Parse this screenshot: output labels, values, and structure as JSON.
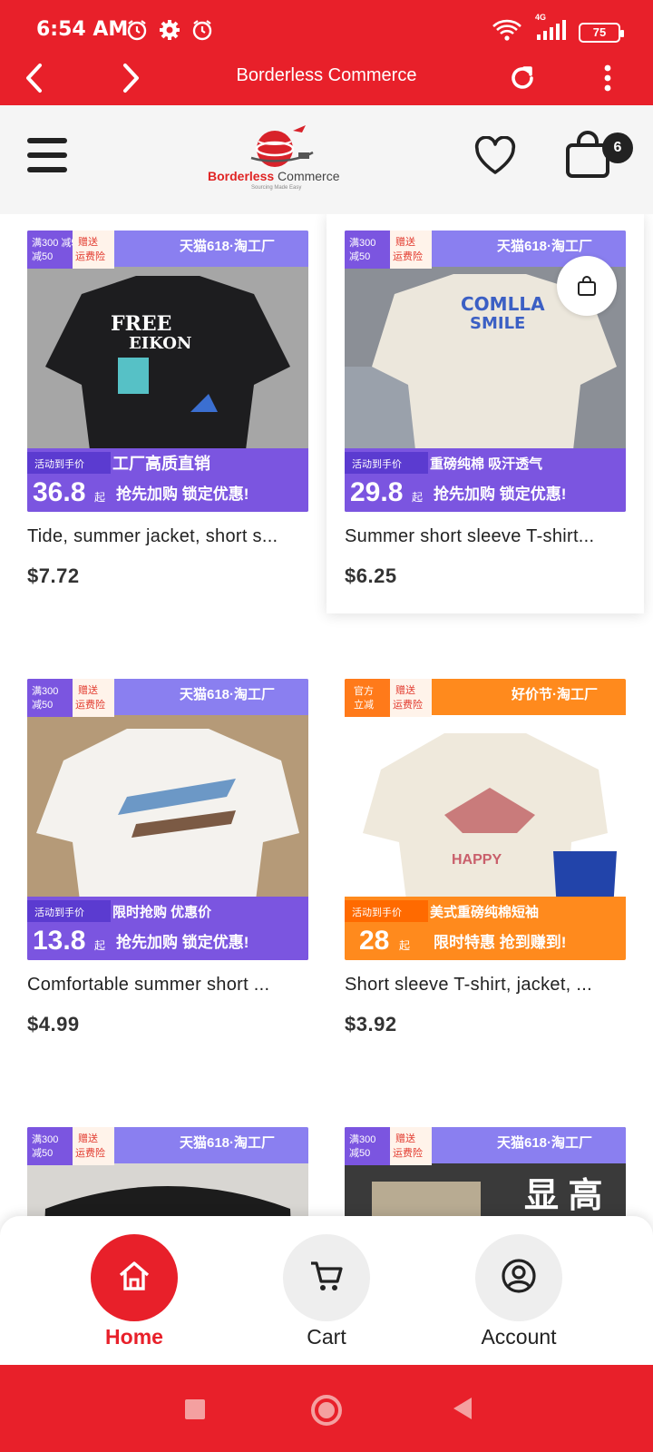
{
  "status_bar": {
    "time": "6:54 AM",
    "network": "4G",
    "battery": "75",
    "icons": [
      "alarm-icon",
      "gear-icon",
      "alarm-icon",
      "wifi-icon",
      "signal-icon",
      "battery-icon"
    ]
  },
  "browser_bar": {
    "title": "Borderless Commerce",
    "back_icon": "chevron-left-icon",
    "forward_icon": "chevron-right-icon",
    "reload_icon": "reload-icon",
    "menu_icon": "more-vertical-icon"
  },
  "header": {
    "logo_brand_part1": "Borderless",
    "logo_brand_part2": "Commerce",
    "logo_tagline": "Sourcing Made Easy",
    "cart_count": "6",
    "accent_color": "#e8202a"
  },
  "products": [
    {
      "name": "Tide, summer jacket, short s...",
      "price": "$7.72",
      "promo_price": "36.8",
      "tag": "工厂高质直销",
      "store": "天猫618·淘工厂",
      "theme": "purple",
      "shirt_color": "#1d1d1f",
      "bg": "#a6a6a6"
    },
    {
      "name": "Summer short sleeve T-shirt...",
      "price": "$6.25",
      "promo_price": "29.8",
      "tag": "重磅纯棉 吸汗透气",
      "store": "天猫618·淘工厂",
      "theme": "purple",
      "shirt_color": "#ece7dc",
      "bg": "#8b8f96"
    },
    {
      "name": "Comfortable summer short ...",
      "price": "$4.99",
      "promo_price": "13.8",
      "tag": "限时抢购 优惠价",
      "store": "天猫618·淘工厂",
      "theme": "purple",
      "shirt_color": "#f4f2ee",
      "bg": "#b59a78"
    },
    {
      "name": "Short sleeve T-shirt, jacket, ...",
      "price": "$3.92",
      "promo_price": "28",
      "tag": "美式重磅纯棉短袖",
      "store": "好价节·淘工厂",
      "theme": "orange",
      "shirt_color": "#efe9dc",
      "bg": "#ffffff"
    },
    {
      "name": "",
      "price": "",
      "promo_price": "",
      "tag": "",
      "store": "天猫618·淘工厂",
      "theme": "purple",
      "shirt_color": "#1c1c1c",
      "bg": "#d8d6d2"
    },
    {
      "name": "",
      "price": "",
      "promo_price": "",
      "tag": "",
      "store": "天猫618·淘工厂",
      "theme": "purple",
      "shirt_color": "#b8ab92",
      "bg": "#3a3a3a"
    }
  ],
  "promo_labels": {
    "badge_left": "满300\n减50",
    "badge_left_official": "官方\n立减",
    "badge_right": "赠送\n运费险",
    "activity": "活动到手价",
    "qi": "起",
    "cta": "抢先加购 锁定优惠!",
    "cta_orange": "限时特惠 抢到赚到!",
    "big_text": "显 高"
  },
  "bottom_nav": {
    "tabs": [
      {
        "label": "Home",
        "icon": "home-icon",
        "active": true
      },
      {
        "label": "Cart",
        "icon": "cart-icon",
        "active": false
      },
      {
        "label": "Account",
        "icon": "account-icon",
        "active": false
      }
    ]
  },
  "system_nav": {
    "icons": [
      "square-icon",
      "circle-icon",
      "triangle-back-icon"
    ]
  }
}
